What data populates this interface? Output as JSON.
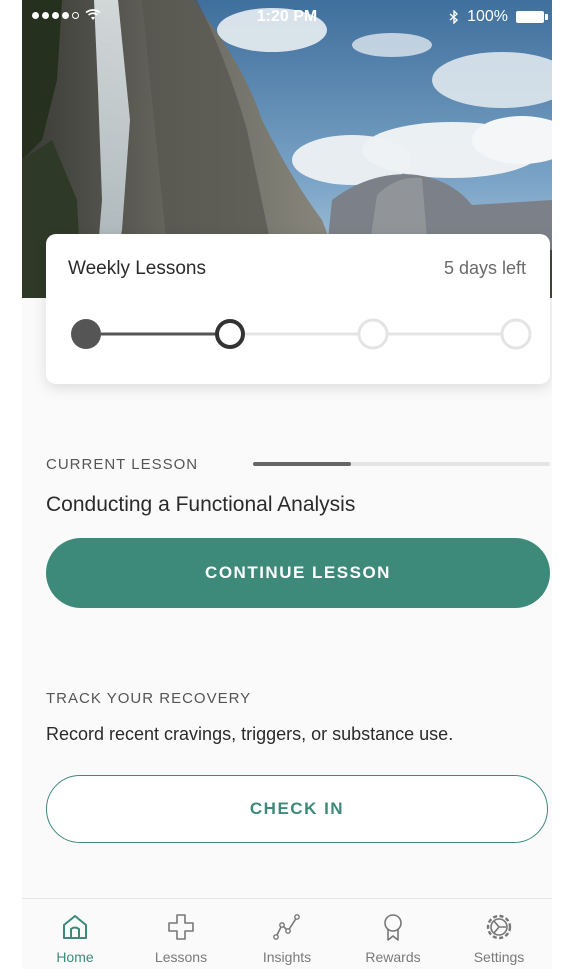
{
  "status_bar": {
    "time": "1:20 PM",
    "battery": "100%"
  },
  "weekly_card": {
    "title": "Weekly Lessons",
    "days_left": "5 days left",
    "steps_total": 4,
    "step_states": [
      "completed",
      "current",
      "upcoming",
      "upcoming"
    ]
  },
  "current_lesson": {
    "label": "CURRENT LESSON",
    "progress": 0.33,
    "name": "Conducting a Functional Analysis",
    "button_label": "CONTINUE LESSON"
  },
  "track": {
    "label": "TRACK YOUR RECOVERY",
    "description": "Record recent cravings, triggers, or substance use.",
    "button_label": "CHECK IN"
  },
  "tabs": [
    {
      "label": "Home",
      "icon": "home-icon",
      "active": true
    },
    {
      "label": "Lessons",
      "icon": "plus-cross-icon",
      "active": false
    },
    {
      "label": "Insights",
      "icon": "insights-line-icon",
      "active": false
    },
    {
      "label": "Rewards",
      "icon": "ribbon-award-icon",
      "active": false
    },
    {
      "label": "Settings",
      "icon": "gear-icon",
      "active": false
    }
  ],
  "colors": {
    "accent": "#3d8a7a",
    "progress_dark": "#555555",
    "progress_light": "#e4e4e4"
  }
}
